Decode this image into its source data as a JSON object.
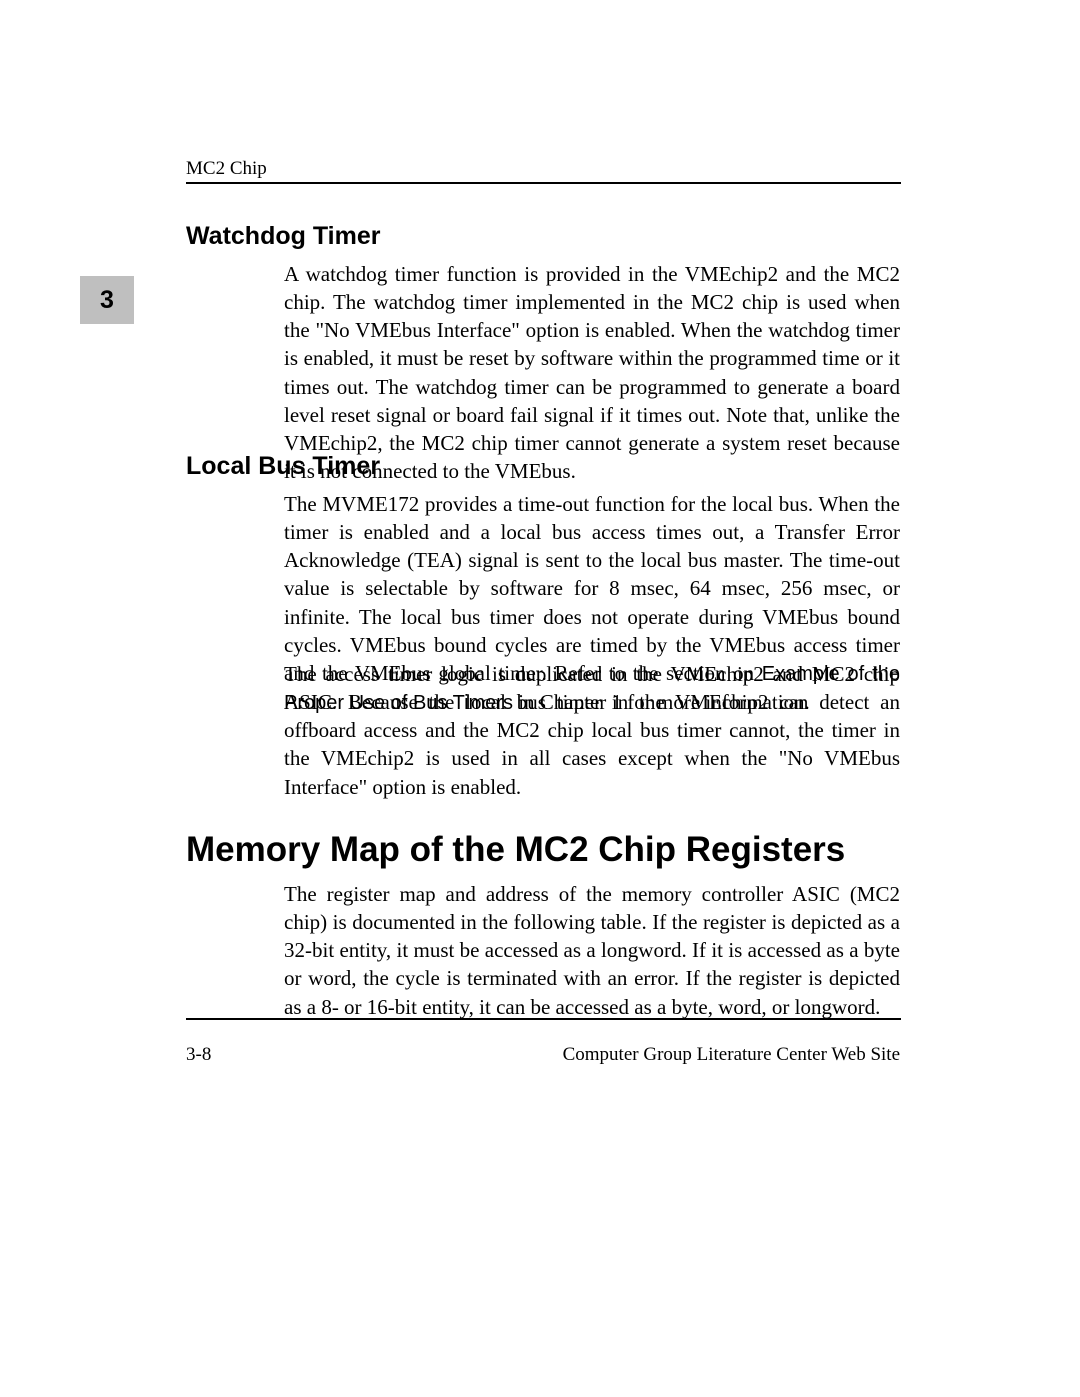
{
  "header": {
    "running_head": "MC2 Chip",
    "chapter_number": "3"
  },
  "sections": {
    "watchdog": {
      "title": "Watchdog Timer",
      "p1": "A watchdog timer function is provided in the VMEchip2 and the MC2 chip. The watchdog timer implemented in the MC2 chip is used when the \"No VMEbus Interface\" option is enabled. When the watchdog timer is enabled, it must be reset by software within the programmed time or it times out. The watchdog timer can be programmed to generate a board level reset signal or board fail signal if it times out. Note that, unlike the VMEchip2, the MC2 chip timer cannot generate a system reset because it is not connected to the VMEbus."
    },
    "localbus": {
      "title": "Local Bus Timer",
      "p1_a": "The MVME172 provides a time-out function for the local bus. When the timer is enabled and a local bus access times out, a Transfer Error Acknowledge (TEA) signal is sent to the local bus master. The time-out value is selectable by software for 8 msec, 64 msec, 256 msec, or infinite. The local bus timer does not operate during VMEbus bound cycles. VMEbus bound cycles are timed by the VMEbus access timer and the VMEbus global timer. Refer to the section on ",
      "p1_ref": "Example of the Proper Use of Bus Timers",
      "p1_b": " in Chapter 1 for more information.",
      "p2": "The access timer logic is duplicated in the VMEchip2 and MC2 chip ASIC. Because the local bus timer in the VMEchip2 can detect an offboard access and the MC2 chip local bus timer cannot, the timer in the VMEchip2 is used in all cases except when the \"No VMEbus Interface\" option is enabled."
    },
    "memorymap": {
      "title": "Memory Map of the MC2 Chip Registers",
      "p1": "The register map and address of the memory controller ASIC (MC2 chip) is documented in the following table. If the register is depicted as a 32-bit entity, it must be accessed as a longword. If it is accessed as a byte or word, the cycle is terminated with an error. If the register is depicted as a 8- or 16-bit entity, it can be accessed as a byte, word, or longword."
    }
  },
  "footer": {
    "page_number": "3-8",
    "site": "Computer Group Literature Center Web Site"
  }
}
